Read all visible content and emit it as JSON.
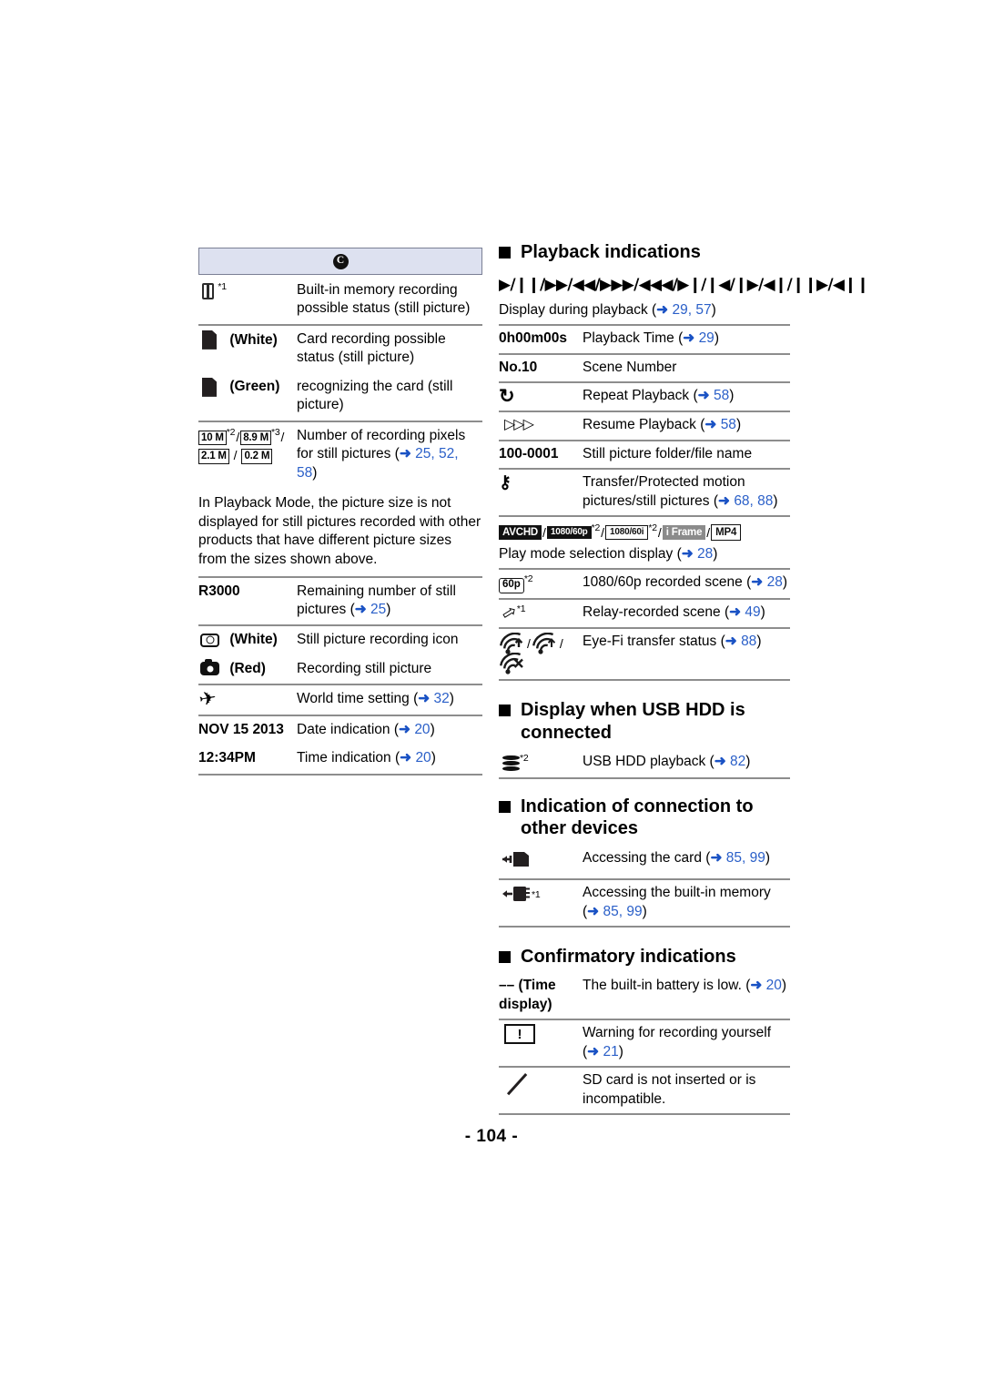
{
  "page": {
    "number": "- 104 -"
  },
  "left_column": {
    "header_badge": "C",
    "rows": [
      {
        "icon": "builtin-memory-chip-icon",
        "icon_label": "",
        "footnote": "*1",
        "desc": "Built-in memory recording possible status (still picture)"
      },
      {
        "icon": "sd-card-icon",
        "icon_label": "(White)",
        "footnote": "",
        "desc": "Card recording possible status (still picture)"
      },
      {
        "icon": "sd-card-icon",
        "icon_label": "(Green)",
        "footnote": "",
        "desc": "recognizing the card (still picture)"
      }
    ],
    "pixel_row": {
      "badges": [
        "10 M",
        "8.9 M",
        "2.1 M",
        "0.2 M"
      ],
      "footnotes": [
        "*2",
        "*3"
      ],
      "desc_prefix": "Number of recording pixels for still pictures (",
      "desc_pages": "25, 52, 58",
      "desc_suffix": ")"
    },
    "note": "In Playback Mode, the picture size is not displayed for still pictures recorded with other products that have different picture sizes from the sizes shown above.",
    "rows2": [
      {
        "label": "R3000",
        "desc_prefix": "Remaining number of still pictures (",
        "page": "25",
        "desc_suffix": ")"
      },
      {
        "icon": "still-picture-record-outline-icon",
        "icon_label": "(White)",
        "desc_prefix": "Still picture recording icon",
        "page": "",
        "desc_suffix": ""
      },
      {
        "icon": "still-picture-record-filled-icon",
        "icon_label": "(Red)",
        "desc_prefix": "Recording still picture",
        "page": "",
        "desc_suffix": ""
      },
      {
        "icon": "airplane-icon",
        "icon_label": "",
        "desc_prefix": "World time setting (",
        "page": "32",
        "desc_suffix": ")"
      },
      {
        "label": "NOV 15 2013",
        "desc_prefix": "Date indication (",
        "page": "20",
        "desc_suffix": ")"
      },
      {
        "label": "12:34PM",
        "desc_prefix": "Time indication (",
        "page": "20",
        "desc_suffix": ")"
      }
    ]
  },
  "right_column": {
    "sections": [
      {
        "title": "Playback indications",
        "glyph_row": "▶/❙❙/▶▶/◀◀/▶▶▶/◀◀◀/▶❙/❙◀/❙▶/◀❙/❙❙▶/◀❙❙",
        "glyph_caption_prefix": "Display during playback (",
        "glyph_caption_pages": "29, 57",
        "glyph_caption_suffix": ")",
        "rows": [
          {
            "label": "0h00m00s",
            "desc_prefix": "Playback Time (",
            "page": "29",
            "desc_suffix": ")"
          },
          {
            "label": "No.10",
            "desc_prefix": "Scene Number",
            "page": "",
            "desc_suffix": ""
          },
          {
            "icon": "repeat-playback-icon",
            "desc_prefix": "Repeat Playback (",
            "page": "58",
            "desc_suffix": ")"
          },
          {
            "icon": "resume-playback-icon",
            "desc_prefix": "Resume Playback (",
            "page": "58",
            "desc_suffix": ")"
          },
          {
            "label": "100-0001",
            "desc_prefix": "Still picture folder/file name",
            "page": "",
            "desc_suffix": ""
          },
          {
            "icon": "key-protected-icon",
            "desc_prefix": "Transfer/Protected motion pictures/still pictures (",
            "page": "68, 88",
            "desc_suffix": ")"
          }
        ],
        "format_badges": [
          {
            "text": "AVCHD",
            "style": "dark",
            "footnote": ""
          },
          {
            "text": "1080/60p",
            "style": "dark",
            "footnote": "*2"
          },
          {
            "text": "1080/60i",
            "style": "outline",
            "footnote": "*2"
          },
          {
            "text": "i Frame",
            "style": "gray",
            "footnote": ""
          },
          {
            "text": "MP4",
            "style": "outline",
            "footnote": ""
          }
        ],
        "format_caption_prefix": "Play mode selection display (",
        "format_caption_page": "28",
        "format_caption_suffix": ")",
        "rows2": [
          {
            "badge": "60p",
            "footnote": "*2",
            "desc_prefix": "1080/60p recorded scene (",
            "page": "28",
            "desc_suffix": ")"
          },
          {
            "icon": "relay-recorded-arrow-icon",
            "footnote": "*1",
            "desc_prefix": "Relay-recorded scene (",
            "page": "49",
            "desc_suffix": ")"
          },
          {
            "icon": "eye-fi-transfer-icon",
            "footnote": "",
            "desc_prefix": "Eye-Fi transfer status (",
            "page": "88",
            "desc_suffix": ")"
          }
        ]
      },
      {
        "title": "Display when USB HDD is connected",
        "rows": [
          {
            "icon": "usb-hdd-icon",
            "footnote": "*2",
            "desc_prefix": "USB HDD playback (",
            "page": "82",
            "desc_suffix": ")"
          }
        ]
      },
      {
        "title": "Indication of connection to other devices",
        "rows": [
          {
            "icon": "accessing-card-icon",
            "footnote": "",
            "desc_prefix": "Accessing the card (",
            "page": "85, 99",
            "desc_suffix": ")"
          },
          {
            "icon": "accessing-builtin-memory-icon",
            "footnote": "*1",
            "desc_prefix": "Accessing the built-in memory (",
            "page": "85, 99",
            "desc_suffix": ")"
          }
        ]
      },
      {
        "title": "Confirmatory indications",
        "rows": [
          {
            "label": "–– (Time display)",
            "desc_prefix": "The built-in battery is low. (",
            "page": "20",
            "desc_suffix": ")"
          },
          {
            "icon": "warning-exclamation-icon",
            "desc_prefix": "Warning for recording yourself (",
            "page": "21",
            "desc_suffix": ")"
          },
          {
            "icon": "no-sd-card-icon",
            "desc_prefix": "SD card is not inserted or is incompatible.",
            "page": "",
            "desc_suffix": ""
          }
        ]
      }
    ]
  },
  "colors": {
    "header_band": "#dde1f0",
    "rule": "#8d8d8d",
    "page_link": "#2a5fc8",
    "badge_dark": "#111111",
    "badge_gray": "#8b8b8b"
  }
}
